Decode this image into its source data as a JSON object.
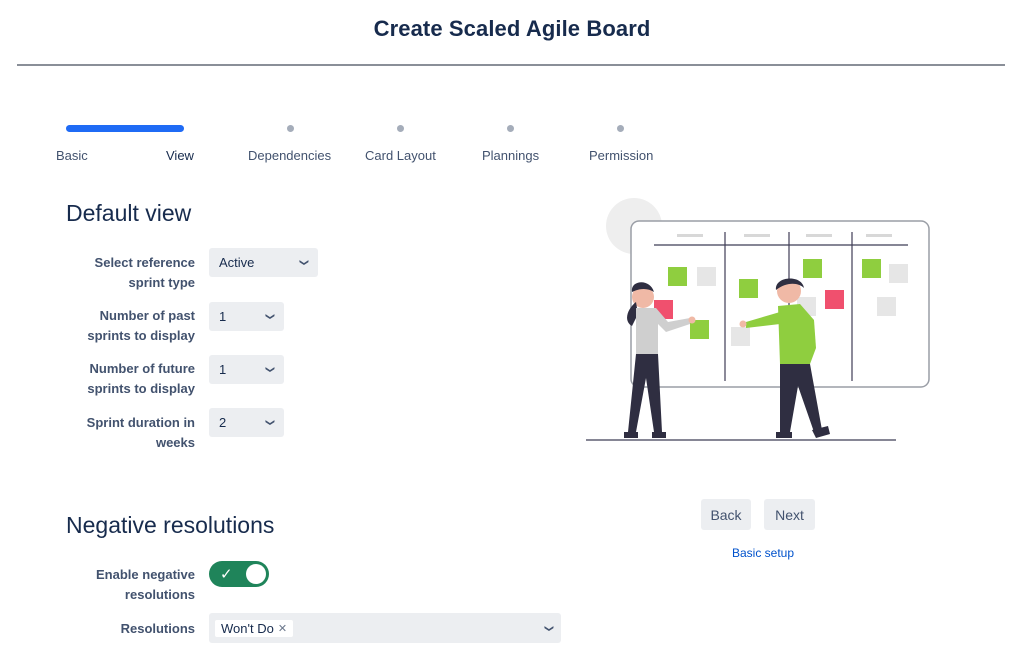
{
  "header": {
    "title": "Create Scaled Agile Board"
  },
  "stepper": {
    "steps": [
      {
        "label": "Basic"
      },
      {
        "label": "View"
      },
      {
        "label": "Dependencies"
      },
      {
        "label": "Card Layout"
      },
      {
        "label": "Plannings"
      },
      {
        "label": "Permission"
      }
    ],
    "current_index": 1
  },
  "default_view": {
    "heading": "Default view",
    "fields": [
      {
        "label_line1": "Select reference",
        "label_line2": "sprint type",
        "value": "Active"
      },
      {
        "label_line1": "Number of past",
        "label_line2": "sprints to display",
        "value": "1"
      },
      {
        "label_line1": "Number of future",
        "label_line2": "sprints to display",
        "value": "1"
      },
      {
        "label_line1": "Sprint duration in",
        "label_line2": "weeks",
        "value": "2"
      }
    ]
  },
  "negative_resolutions": {
    "heading": "Negative resolutions",
    "enable_label_line1": "Enable negative",
    "enable_label_line2": "resolutions",
    "enabled": true,
    "resolutions_label": "Resolutions",
    "resolutions": [
      "Won't Do"
    ]
  },
  "actions": {
    "back_label": "Back",
    "next_label": "Next",
    "basic_setup_link": "Basic setup"
  },
  "icons": {
    "select_chevron": "chevron-down-icon",
    "chip_remove": "close-icon",
    "toggle_check": "check-icon"
  },
  "colors": {
    "accent": "#1f6bf5",
    "toggle_on": "#1f845a",
    "illustration_green": "#8fce3f",
    "illustration_pink": "#f0506e",
    "link": "#0052cc"
  }
}
